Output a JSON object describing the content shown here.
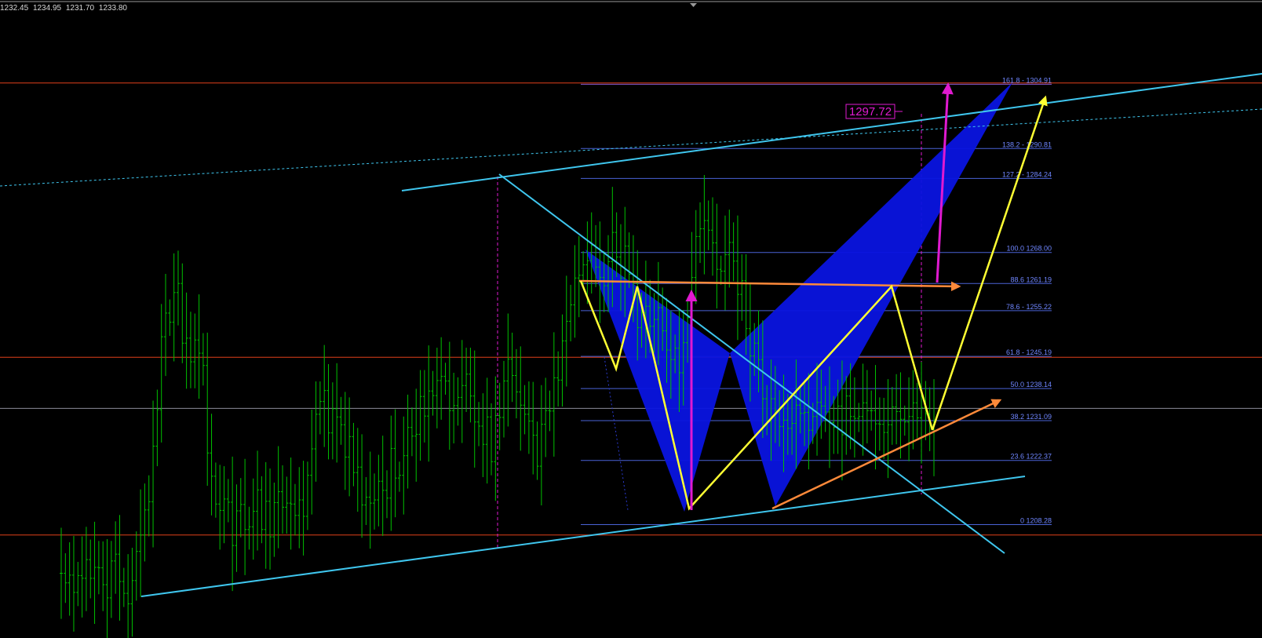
{
  "header": {
    "ohlc": [
      "1232.45",
      "1234.95",
      "1231.70",
      "1233.80"
    ]
  },
  "colors": {
    "background": "#000000",
    "bars": "#00c000",
    "channel": "#3fc6ee",
    "fib": "#4a63d6",
    "fib_label": "#6f86ff",
    "pattern_fill": "#0a14e0",
    "yellow": "#ffff33",
    "orange": "#ff8a3a",
    "magenta": "#e01ad0",
    "red_line": "#e0401a",
    "grey_line": "#8c8c98"
  },
  "chart_data": {
    "type": "bar",
    "title": "",
    "grid": false,
    "price_box_label": "1297.72",
    "fib_levels": [
      {
        "ratio": "161.8",
        "price": 1304.91,
        "label": "161.8 - 1304.91"
      },
      {
        "ratio": "138.2",
        "price": 1290.81,
        "label": "138.2 - 1290.81"
      },
      {
        "ratio": "127.2",
        "price": 1284.24,
        "label": "127.2 - 1284.24"
      },
      {
        "ratio": "100.0",
        "price": 1268.0,
        "label": "100.0 1268.00"
      },
      {
        "ratio": "88.6",
        "price": 1261.19,
        "label": "88.6 1261.19"
      },
      {
        "ratio": "78.6",
        "price": 1255.22,
        "label": "78.6 - 1255.22"
      },
      {
        "ratio": "61.8",
        "price": 1245.19,
        "label": "61.8 - 1245.19"
      },
      {
        "ratio": "50.0",
        "price": 1238.14,
        "label": "50.0 1238.14"
      },
      {
        "ratio": "38.2",
        "price": 1231.09,
        "label": "38.2 1231.09"
      },
      {
        "ratio": "23.6",
        "price": 1222.37,
        "label": "23.6 1222.37"
      },
      {
        "ratio": "0",
        "price": 1208.28,
        "label": "0 1208.28"
      }
    ],
    "horizontal_levels": [
      {
        "name": "resistance-top",
        "price": 1305.2,
        "color": "red_line"
      },
      {
        "name": "resistance-mid",
        "price": 1245.0,
        "color": "red_line"
      },
      {
        "name": "current-price",
        "price": 1233.8,
        "color": "grey_line"
      },
      {
        "name": "support-bottom",
        "price": 1206.0,
        "color": "red_line"
      }
    ],
    "price_axis": {
      "top": 1323.4,
      "bottom": 1183.4
    },
    "bar_count": 220,
    "series": [
      {
        "values": [
          1197.6,
          1195.5,
          1197.2,
          1193.4,
          1197.1,
          1196.5,
          1200.6,
          1196.5,
          1198.9,
          1198.8,
          1195.1,
          1192.2,
          1200.3,
          1201.8,
          1195.8,
          1193.2,
          1190.9,
          1196.0,
          1202.4,
          1206.0,
          1211.5,
          1213.3,
          1225.5,
          1233.5,
          1249.5,
          1254.7,
          1252.7,
          1259.2,
          1261.2,
          1248.1,
          1249.2,
          1244.0,
          1248.8,
          1245.9,
          1243.2,
          1224.0,
          1218.9,
          1212.8,
          1211.4,
          1213.9,
          1213.2,
          1203.7,
          1211.3,
          1212.7,
          1207.2,
          1207.8,
          1211.2,
          1215.9,
          1207.2,
          1213.4,
          1205.6,
          1213.1,
          1215.5,
          1212.1,
          1213.0,
          1212.8,
          1210.3,
          1213.7,
          1210.1,
          1219.1,
          1224.9,
          1232.5,
          1235.3,
          1237.7,
          1228.4,
          1233.7,
          1231.9,
          1230.2,
          1223.1,
          1227.6,
          1219.7,
          1220.9,
          1212.6,
          1214.3,
          1213.0,
          1213.7,
          1217.8,
          1215.8,
          1214.1,
          1225.0,
          1218.5,
          1219.1,
          1223.4,
          1229.6,
          1227.7,
          1228.1,
          1236.4,
          1232.1,
          1237.6,
          1236.6,
          1239.9,
          1240.8,
          1239.8,
          1233.3,
          1234.4,
          1236.2,
          1238.8,
          1241.3,
          1236.5,
          1230.8,
          1229.9,
          1225.9,
          1231.9,
          1222.1,
          1232.2,
          1231.8,
          1239.8,
          1244.6,
          1241.0,
          1237.4,
          1234.5,
          1232.5,
          1231.0,
          1227.9,
          1221.1,
          1230.3,
          1233.3,
          1233.2,
          1240.5,
          1240.0,
          1248.6,
          1252.9,
          1256.5,
          1262.4,
          1263.0,
          1265.3,
          1266.2,
          1269.6,
          1264.8,
          1262.5,
          1260.7,
          1266.0,
          1272.4,
          1267.0,
          1262.4,
          1269.4,
          1263.2,
          1261.3,
          1251.5,
          1254.8,
          1256.2,
          1251.8,
          1253.3,
          1255.9,
          1250.8,
          1246.6,
          1244.5,
          1247.0,
          1241.6,
          1248.2,
          1253.7,
          1262.5,
          1271.5,
          1273.2,
          1275.0,
          1272.9,
          1270.1,
          1264.3,
          1263.9,
          1267.5,
          1270.2,
          1266.1,
          1258.8,
          1261.8,
          1251.3,
          1245.3,
          1248.1,
          1244.5,
          1235.9,
          1230.9,
          1235.9,
          1233.4,
          1229.8,
          1231.2,
          1229.4,
          1230.5,
          1234.5,
          1232.7,
          1232.9,
          1229.0,
          1232.0,
          1235.1,
          1234.3,
          1233.0,
          1230.7,
          1229.6,
          1234.3,
          1228.0,
          1236.5,
          1232.0,
          1231.6,
          1232.0,
          1235.0,
          1233.3,
          1233.3,
          1230.4,
          1230.3,
          1228.5,
          1230.2,
          1234.1,
          1233.1,
          1231.4,
          1230.8,
          1232.0,
          1235.0,
          1231.7,
          1234.0,
          1232.6,
          1230.2,
          1228.9
        ]
      }
    ]
  }
}
